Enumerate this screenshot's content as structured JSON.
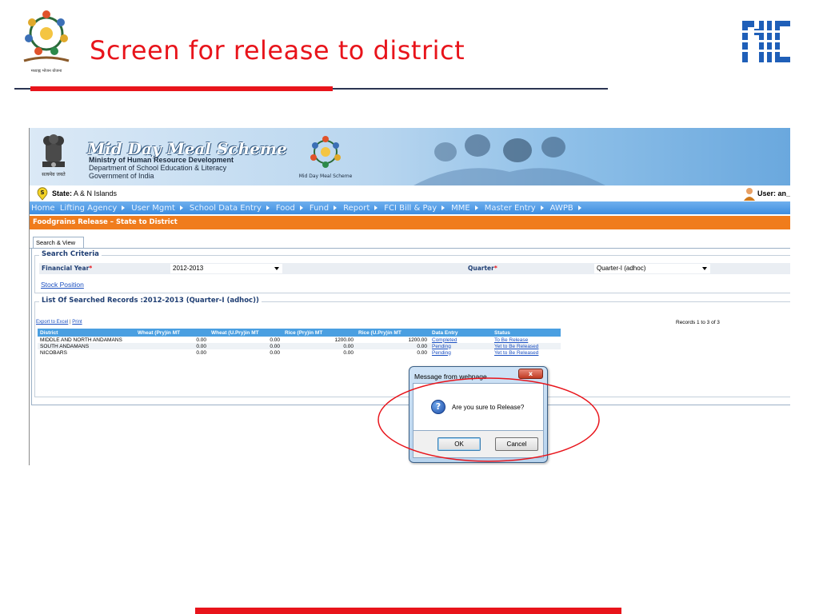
{
  "slide": {
    "title": "Screen for release to district",
    "logo_left_caption": "मध्याह्न भोजन योजना"
  },
  "banner": {
    "title": "Mid Day Meal Scheme",
    "line1": "Ministry of Human Resource Development",
    "line2": "Department of School Education & Literacy",
    "line3": "Government of India",
    "emblem_caption": "सत्यमेव जयते",
    "logo_caption": "Mid Day Meal Scheme"
  },
  "statebar": {
    "state_label": "State:",
    "state_value": "A & N Islands",
    "user_label": "User:",
    "user_value": "an_s"
  },
  "menu": {
    "items": [
      "Home",
      "Lifting Agency",
      "User Mgmt",
      "School Data Entry",
      "Food",
      "Fund",
      "Report",
      "FCI Bill & Pay",
      "MME",
      "Master Entry",
      "AWPB"
    ]
  },
  "page_header": "Foodgrains Release – State to District",
  "tab": "Search & View",
  "search": {
    "legend": "Search Criteria",
    "financial_year_label": "Financial Year",
    "financial_year_value": "2012-2013",
    "quarter_label": "Quarter",
    "quarter_value": "Quarter-I (adhoc)",
    "required_mark": "*",
    "stock_link": "Stock Position"
  },
  "records": {
    "legend": "List Of Searched Records :2012-2013 (Quarter-I (adhoc))",
    "export_excel": "Export to Excel",
    "separator": "|",
    "print": "Print",
    "count_text": "Records 1 to 3 of 3",
    "columns": [
      "District",
      "Wheat (Pry)in MT",
      "Wheat (U.Pry)in MT",
      "Rice (Pry)in MT",
      "Rice (U.Pry)in MT",
      "Data Entry",
      "Status"
    ],
    "rows": [
      {
        "district": "MIDDLE AND NORTH ANDAMANS",
        "wheat_pry": "0.00",
        "wheat_upry": "0.00",
        "rice_pry": "1200.00",
        "rice_upry": "1200.00",
        "data_entry": "Completed",
        "status": "To Be Release"
      },
      {
        "district": "SOUTH ANDAMANS",
        "wheat_pry": "0.00",
        "wheat_upry": "0.00",
        "rice_pry": "0.00",
        "rice_upry": "0.00",
        "data_entry": "Pending",
        "status": "Yet to Be Released"
      },
      {
        "district": "NICOBARS",
        "wheat_pry": "0.00",
        "wheat_upry": "0.00",
        "rice_pry": "0.00",
        "rice_upry": "0.00",
        "data_entry": "Pending",
        "status": "Yet to Be Released"
      }
    ]
  },
  "dialog": {
    "title": "Message from webpage",
    "close": "x",
    "message": "Are you sure to Release?",
    "ok": "OK",
    "cancel": "Cancel"
  },
  "colors": {
    "title_red": "#e8141b",
    "menu_blue": "#3d8ddf",
    "header_orange": "#f07c1c",
    "grid_header_blue": "#4a9fe1",
    "link_blue": "#1a4fc1"
  },
  "icons": [
    "mdm-logo-icon",
    "nic-logo-icon",
    "emblem-icon",
    "state-badge-icon",
    "user-icon",
    "question-icon",
    "close-icon",
    "chevron-down-icon",
    "menu-arrow-icon"
  ]
}
